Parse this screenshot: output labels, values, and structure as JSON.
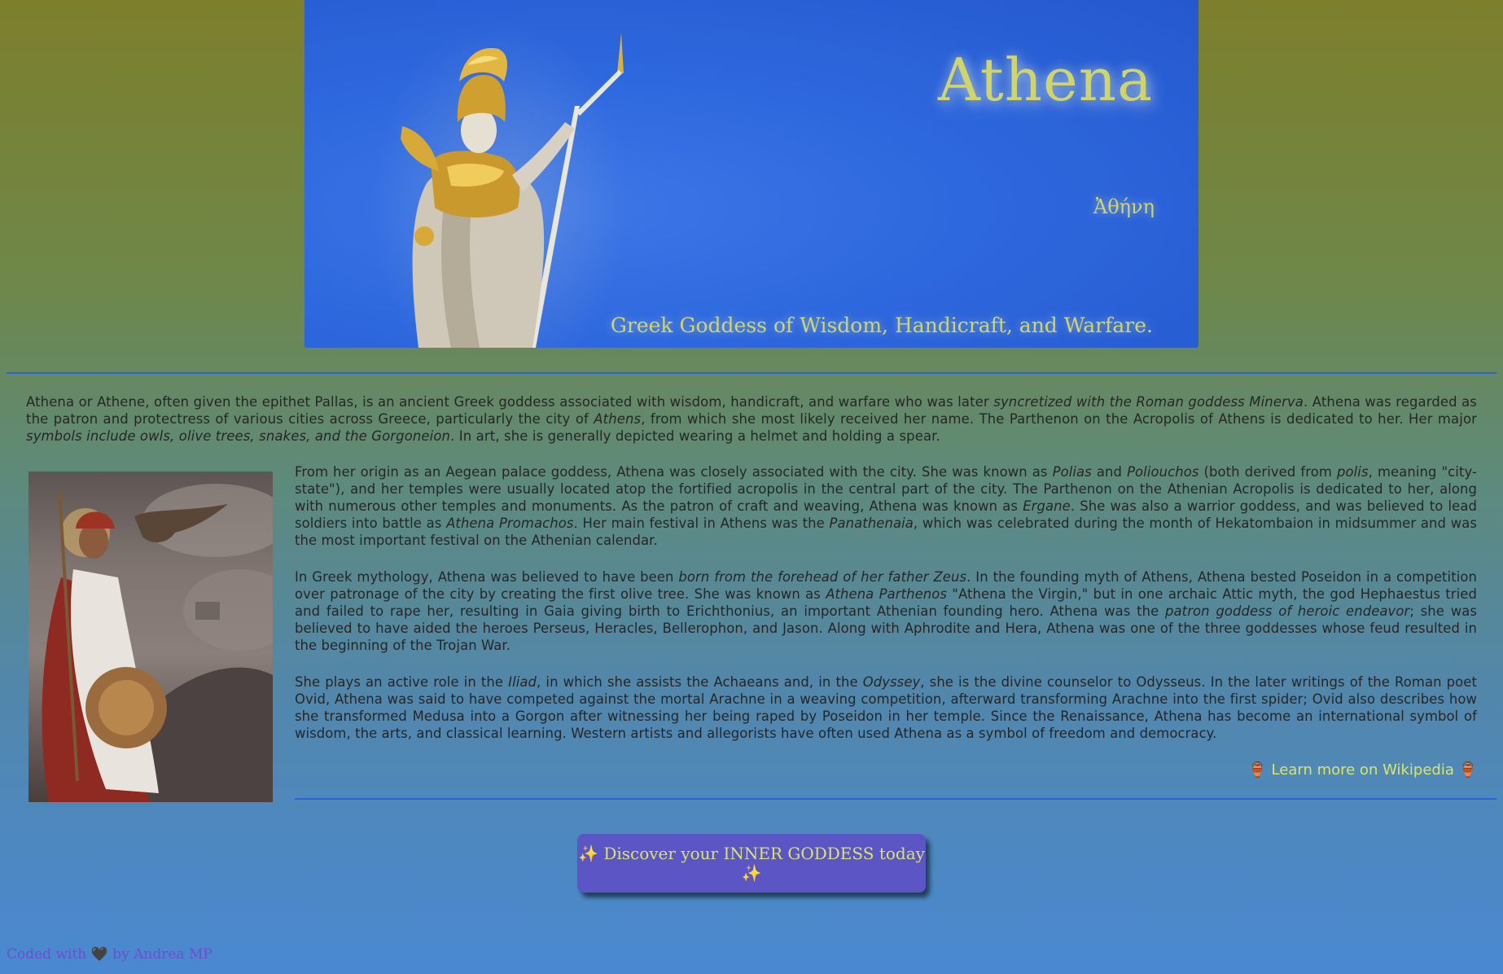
{
  "hero": {
    "title": "Athena",
    "greek": "Ἀθήνη",
    "subtitle": "Greek Goddess of Wisdom, Handicraft, and Warfare."
  },
  "intro": {
    "t1": "Athena or Athene, often given the epithet Pallas, is an ancient Greek goddess associated with wisdom, handicraft, and warfare who was later ",
    "i1": "syncretized with the Roman goddess Minerva",
    "t2": ". Athena was regarded as the patron and protectress of various cities across Greece, particularly the city of ",
    "i2": "Athens",
    "t3": ", from which she most likely received her name. The Parthenon on the Acropolis of Athens is dedicated to her. Her major ",
    "i3": "symbols include owls, olive trees, snakes, and the Gorgoneion",
    "t4": ". In art, she is generally depicted wearing a helmet and holding a spear."
  },
  "p1": {
    "t1": "From her origin as an Aegean palace goddess, Athena was closely associated with the city. She was known as ",
    "i1": "Polias",
    "t2": " and ",
    "i2": "Poliouchos",
    "t3": " (both derived from ",
    "i3": "polis",
    "t4": ", meaning \"city-state\"), and her temples were usually located atop the fortified acropolis in the central part of the city. The Parthenon on the Athenian Acropolis is dedicated to her, along with numerous other temples and monuments. As the patron of craft and weaving, Athena was known as ",
    "i4": "Ergane",
    "t5": ". She was also a warrior goddess, and was believed to lead soldiers into battle as ",
    "i5": "Athena Promachos",
    "t6": ". Her main festival in Athens was the ",
    "i6": "Panathenaia",
    "t7": ", which was celebrated during the month of Hekatombaion in midsummer and was the most important festival on the Athenian calendar."
  },
  "p2": {
    "t1": "In Greek mythology, Athena was believed to have been ",
    "i1": "born from the forehead of her father Zeus",
    "t2": ". In the founding myth of Athens, Athena bested Poseidon in a competition over patronage of the city by creating the first olive tree. She was known as ",
    "i2": "Athena Parthenos",
    "t3": " \"Athena the Virgin,\" but in one archaic Attic myth, the god Hephaestus tried and failed to rape her, resulting in Gaia giving birth to Erichthonius, an important Athenian founding hero. Athena was the ",
    "i3": "patron goddess of heroic endeavor",
    "t4": "; she was believed to have aided the heroes Perseus, Heracles, Bellerophon, and Jason. Along with Aphrodite and Hera, Athena was one of the three goddesses whose feud resulted in the beginning of the Trojan War."
  },
  "p3": {
    "t1": "She plays an active role in the ",
    "i1": "Iliad",
    "t2": ", in which she assists the Achaeans and, in the ",
    "i2": "Odyssey",
    "t3": ", she is the divine counselor to Odysseus. In the later writings of the Roman poet Ovid, Athena was said to have competed against the mortal Arachne in a weaving competition, afterward transforming Arachne into the first spider; Ovid also describes how she transformed Medusa into a Gorgon after witnessing her being raped by Poseidon in her temple. Since the Renaissance, Athena has become an international symbol of wisdom, the arts, and classical learning. Western artists and allegorists have often used Athena as a symbol of freedom and democracy."
  },
  "wiki": {
    "icon_left": "🏺",
    "label": " Learn more on Wikipedia ",
    "icon_right": "🏺"
  },
  "cta": {
    "label": "✨ Discover your INNER GODDESS today ✨"
  },
  "footer": {
    "t1": "Coded with ",
    "heart": "🖤",
    "t2": " by Andrea MP"
  },
  "colors": {
    "accent_text": "#dbe46a",
    "rule": "#2b63d8",
    "button": "#5b55c6",
    "footer_text": "#6b4fd0"
  },
  "images": {
    "hero": "athena-statue-photo",
    "portrait": "athena-owl-illustration"
  }
}
